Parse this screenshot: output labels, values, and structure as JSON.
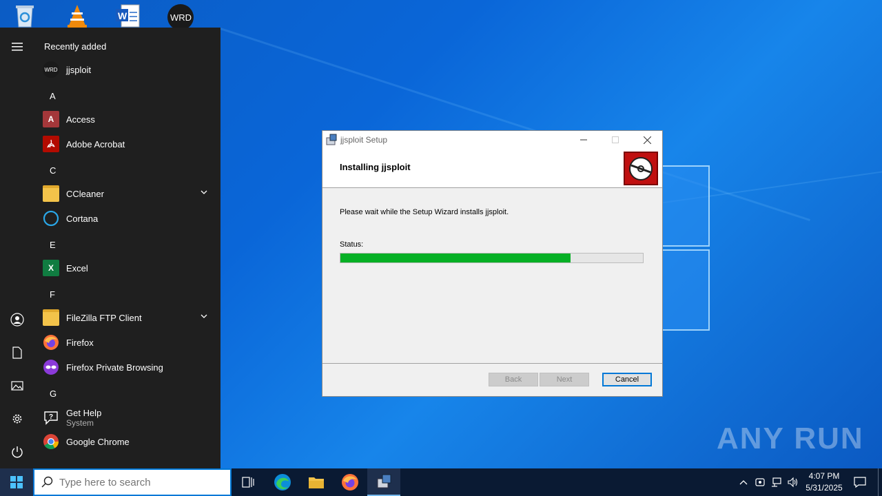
{
  "desktop": {
    "icons": [
      "recycle-bin",
      "vlc",
      "word-document",
      "jjsploit"
    ],
    "watermark": "ANY RUN"
  },
  "start_menu": {
    "section_recently_added": "Recently added",
    "recent_app": "jjsploit",
    "letters": {
      "a": "A",
      "c": "C",
      "e": "E",
      "f": "F",
      "g": "G"
    },
    "apps": {
      "access": "Access",
      "acrobat": "Adobe Acrobat",
      "ccleaner": "CCleaner",
      "cortana": "Cortana",
      "excel": "Excel",
      "filezilla": "FileZilla FTP Client",
      "firefox": "Firefox",
      "firefox_private": "Firefox Private Browsing",
      "get_help": "Get Help",
      "get_help_sub": "System",
      "chrome": "Google Chrome"
    }
  },
  "dialog": {
    "title": "jjsploit Setup",
    "heading": "Installing jjsploit",
    "message": "Please wait while the Setup Wizard installs jjsploit.",
    "status_label": "Status:",
    "progress": 0.76,
    "back_label": "Back",
    "next_label": "Next",
    "cancel_label": "Cancel"
  },
  "taskbar": {
    "search_placeholder": "Type here to search",
    "time": "4:07 PM",
    "date": "5/31/2025"
  },
  "colors": {
    "progress": "#06b025",
    "accent": "#0078d7",
    "start_bg": "#1f1f1f",
    "taskbar_bg": "#0a1a33"
  }
}
